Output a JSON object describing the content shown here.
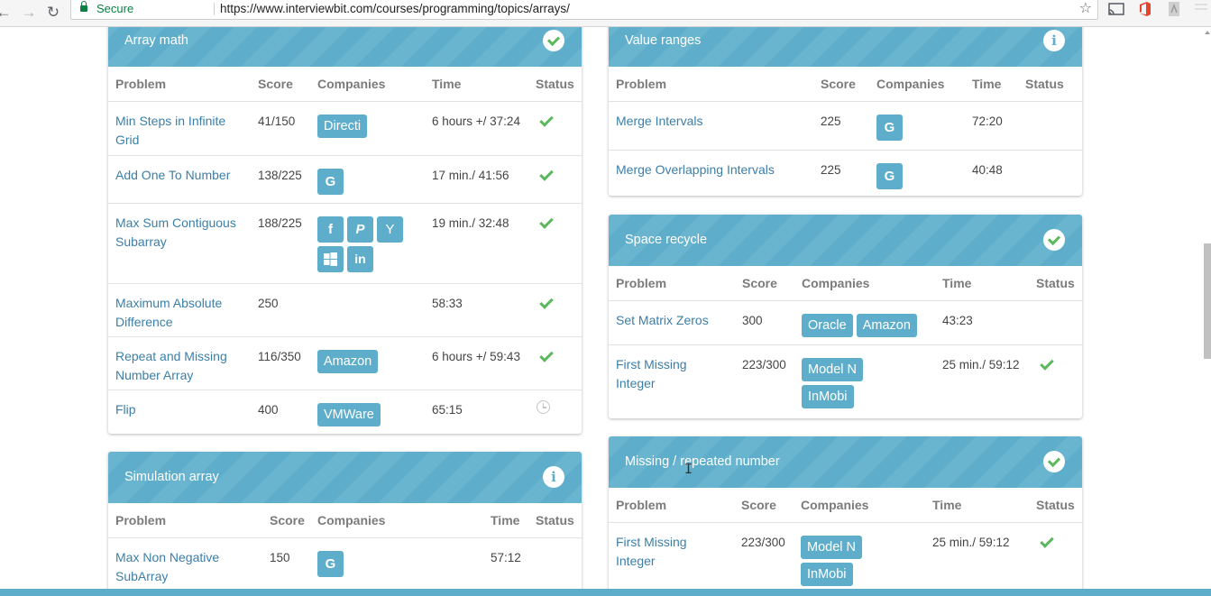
{
  "browser": {
    "secure_label": "Secure",
    "url": "https://www.interviewbit.com/courses/programming/topics/arrays/"
  },
  "colors": {
    "accent": "#5eaecb",
    "link": "#3b7fa8",
    "success": "#5cb85c"
  },
  "columns": {
    "problem": "Problem",
    "score": "Score",
    "companies": "Companies",
    "time": "Time",
    "status": "Status"
  },
  "panels": {
    "array_math": {
      "title": "Array math",
      "header_icon": "check-circle-icon",
      "rows": [
        {
          "problem": "Min Steps in Infinite Grid",
          "score": "41/150",
          "companies": [
            "Directi"
          ],
          "time": "6 hours +/ 37:24",
          "status": "solved"
        },
        {
          "problem": "Add One To Number",
          "score": "138/225",
          "companies": [
            "G"
          ],
          "time": "17 min./ 41:56",
          "status": "solved"
        },
        {
          "problem": "Max Sum Contiguous Subarray",
          "score": "188/225",
          "company_icons": [
            "f",
            "P",
            "Y",
            "windows",
            "in"
          ],
          "time": "19 min./ 32:48",
          "status": "solved"
        },
        {
          "problem": "Maximum Absolute Difference",
          "score": "250",
          "companies": [],
          "time": "58:33",
          "status": "solved"
        },
        {
          "problem": "Repeat and Missing Number Array",
          "score": "116/350",
          "companies": [
            "Amazon"
          ],
          "time": "6 hours +/ 59:43",
          "status": "solved"
        },
        {
          "problem": "Flip",
          "score": "400",
          "companies": [
            "VMWare"
          ],
          "time": "65:15",
          "status": "pending"
        }
      ]
    },
    "simulation_array": {
      "title": "Simulation array",
      "header_icon": "info-icon",
      "rows": [
        {
          "problem": "Max Non Negative SubArray",
          "score": "150",
          "companies": [
            "G"
          ],
          "time": "57:12",
          "status": ""
        }
      ]
    },
    "value_ranges": {
      "title": "Value ranges",
      "header_icon": "info-icon",
      "rows": [
        {
          "problem": "Merge Intervals",
          "score": "225",
          "companies": [
            "G"
          ],
          "time": "72:20",
          "status": ""
        },
        {
          "problem": "Merge Overlapping Intervals",
          "score": "225",
          "companies": [
            "G"
          ],
          "time": "40:48",
          "status": ""
        }
      ]
    },
    "space_recycle": {
      "title": "Space recycle",
      "header_icon": "check-circle-icon",
      "rows": [
        {
          "problem": "Set Matrix Zeros",
          "score": "300",
          "companies": [
            "Oracle",
            "Amazon"
          ],
          "time": "43:23",
          "status": ""
        },
        {
          "problem": "First Missing Integer",
          "score": "223/300",
          "companies": [
            "Model N",
            "InMobi"
          ],
          "time": "25 min./ 59:12",
          "status": "solved"
        }
      ]
    },
    "missing_repeated": {
      "title": "Missing / repeated number",
      "header_icon": "check-circle-icon",
      "rows": [
        {
          "problem": "First Missing Integer",
          "score": "223/300",
          "companies": [
            "Model N",
            "InMobi"
          ],
          "time": "25 min./ 59:12",
          "status": "solved"
        }
      ]
    }
  }
}
